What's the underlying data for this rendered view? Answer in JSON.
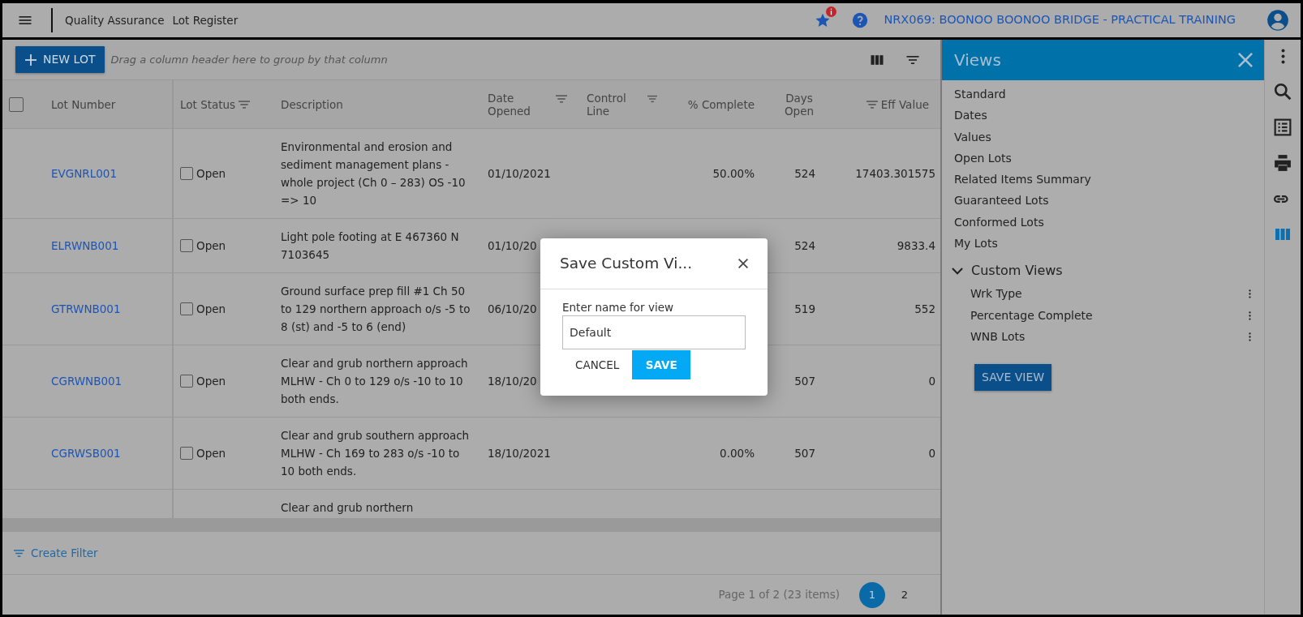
{
  "top_bar": {
    "breadcrumb": [
      "Quality Assurance",
      "Lot Register"
    ],
    "project": "NRX069: BOONOO BOONOO BRIDGE - PRACTICAL TRAINING"
  },
  "toolbar": {
    "new_button": "NEW LOT",
    "group_hint": "Drag a column header here to group by that column"
  },
  "table": {
    "select_all": {
      "checked": false
    },
    "columns": [
      {
        "label": "Lot Number",
        "kind": "text",
        "filter": false
      },
      {
        "label": "Lot Status",
        "kind": "text",
        "filter": true
      },
      {
        "label": "Description",
        "kind": "text",
        "filter": false
      },
      {
        "label": "Date Opened",
        "kind": "text",
        "filter": true
      },
      {
        "label": "Control Line",
        "kind": "text",
        "filter": true
      },
      {
        "label": "% Complete",
        "kind": "number",
        "filter": false
      },
      {
        "label": "Days Open",
        "kind": "number",
        "filter": false
      },
      {
        "label": "Eff Value",
        "kind": "number",
        "filter": true
      }
    ],
    "rows": [
      {
        "lot_number": "EVGNRL001",
        "status": {
          "label": "Open",
          "checked": false
        },
        "description": "Environmental and erosion and sediment management plans - whole project (Ch 0 – 283) OS -10 => 10",
        "date_opened": "01/10/2021",
        "percent_complete": "50.00%",
        "days_open": "524",
        "eff_value": "17403.301575"
      },
      {
        "lot_number": "ELRWNB001",
        "status": {
          "label": "Open",
          "checked": false
        },
        "description": "Light pole footing at E 467360 N 7103645",
        "date_opened": "01/10/20",
        "days_open": "524",
        "eff_value": "9833.4"
      },
      {
        "lot_number": "GTRWNB001",
        "status": {
          "label": "Open",
          "checked": false
        },
        "description": "Ground surface prep fill #1 Ch 50 to 129 northern approach o/s -5 to 8 (st) and -5 to 6 (end)",
        "date_opened": "06/10/20",
        "days_open": "519",
        "eff_value": "552"
      },
      {
        "lot_number": "CGRWNB001",
        "status": {
          "label": "Open",
          "checked": false
        },
        "description": "Clear and grub northern approach MLHW - Ch 0 to 129 o/s -10 to 10 both ends.",
        "date_opened": "18/10/20",
        "days_open": "507",
        "eff_value": "0"
      },
      {
        "lot_number": "CGRWSB001",
        "status": {
          "label": "Open",
          "checked": false
        },
        "description": "Clear and grub southern approach MLHW - Ch 169 to 283 o/s -10 to 10 both ends.",
        "date_opened": "18/10/2021",
        "percent_complete": "0.00%",
        "days_open": "507",
        "eff_value": "0"
      },
      {
        "description": "Clear and grub northern"
      }
    ]
  },
  "filter_bar": {
    "label": "Create Filter"
  },
  "pager": {
    "summary": "Page 1 of 2 (23 items)",
    "pages": [
      {
        "label": "1",
        "selected": true
      },
      {
        "label": "2",
        "selected": false
      }
    ]
  },
  "views_panel": {
    "title": "Views",
    "items": [
      "Standard",
      "Dates",
      "Values",
      "Open Lots",
      "Related Items Summary",
      "Guaranteed Lots",
      "Conformed Lots",
      "My Lots"
    ],
    "custom_group": {
      "label": "Custom Views",
      "expanded": true,
      "items": [
        "Wrk Type",
        "Percentage Complete",
        "WNB Lots"
      ]
    },
    "save_button": "SAVE VIEW"
  },
  "side_tools": [
    {
      "kind": "more",
      "selected": false
    },
    {
      "kind": "search",
      "selected": false
    },
    {
      "kind": "list",
      "selected": false
    },
    {
      "kind": "print",
      "selected": false
    },
    {
      "kind": "link",
      "selected": false
    },
    {
      "kind": "columns",
      "selected": true
    }
  ],
  "dialog": {
    "title": "Save Custom Vi...",
    "field_label": "Enter name for view",
    "value": "Default",
    "cancel": "CANCEL",
    "save": "SAVE"
  }
}
